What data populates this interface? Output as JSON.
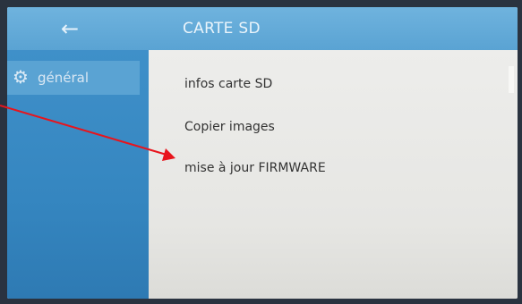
{
  "header": {
    "title": "CARTE SD",
    "back_icon": "arrow-left-icon"
  },
  "sidebar": {
    "items": [
      {
        "label": "général",
        "icon": "gear-icon"
      }
    ]
  },
  "menu": {
    "items": [
      {
        "label": "infos carte SD"
      },
      {
        "label": "Copier images"
      },
      {
        "label": "mise à jour FIRMWARE"
      }
    ]
  },
  "annotation": {
    "arrow_color": "#e8141c",
    "target": "mise à jour FIRMWARE"
  },
  "colors": {
    "topbar": "#5fa9da",
    "sidebar": "#3586c0",
    "content": "#e9e9e6"
  }
}
